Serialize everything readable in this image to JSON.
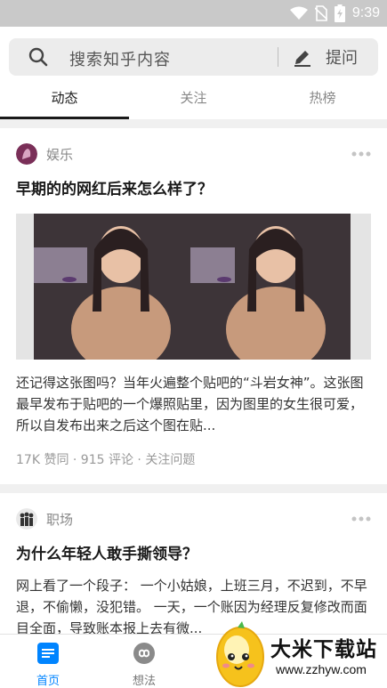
{
  "status_bar": {
    "time": "9:39"
  },
  "header": {
    "search_placeholder": "搜索知乎内容",
    "ask_label": "提问",
    "tabs": [
      {
        "label": "动态",
        "active": true
      },
      {
        "label": "关注",
        "active": false
      },
      {
        "label": "热榜",
        "active": false
      }
    ]
  },
  "feed": {
    "cards": [
      {
        "topic": "娱乐",
        "title": "早期的的网红后来怎么样了？",
        "excerpt": "还记得这张图吗？当年火遍整个贴吧的“斗岩女神”。这张图最早发布于贴吧的一个爆照贴里，因为图里的女生很可爱，所以自发布出来之后这个图在贴...",
        "meta": "17K 赞同 · 915 评论 · 关注问题"
      },
      {
        "topic": "职场",
        "title": "为什么年轻人敢手撕领导？",
        "excerpt": "网上看了一个段子： 一个小姑娘，上班三月，不迟到，不早退，不偷懒，没犯错。 一天，一个账因为经理反复修改而面目全面，导致账本报上去有微..."
      }
    ]
  },
  "bottom_nav": {
    "items": [
      {
        "label": "首页",
        "active": true
      },
      {
        "label": "想法",
        "active": false
      }
    ]
  },
  "watermark": {
    "title": "大米下载站",
    "url": "www.zzhyw.com"
  },
  "colors": {
    "accent": "#0084ff",
    "muted": "#888888",
    "status_bar": "#c9c9c9"
  }
}
